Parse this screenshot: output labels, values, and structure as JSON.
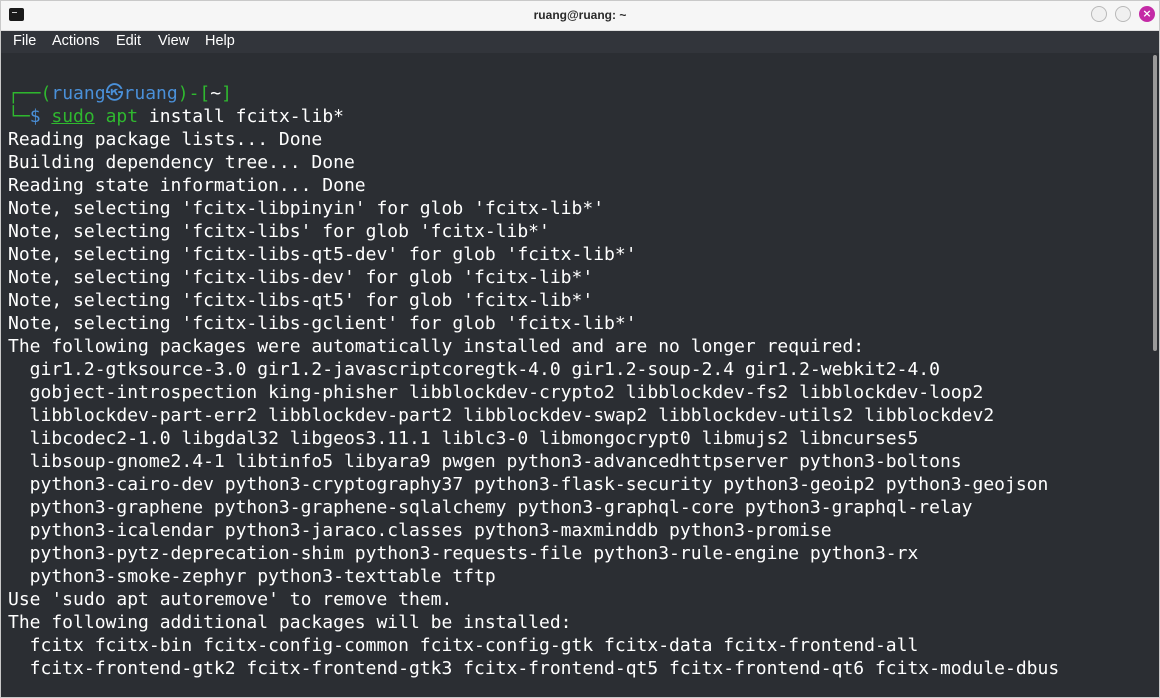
{
  "window": {
    "title": "ruang@ruang: ~",
    "close_glyph": "×"
  },
  "menu": {
    "file": "File",
    "actions": "Actions",
    "edit": "Edit",
    "view": "View",
    "help": "Help"
  },
  "prompt": {
    "corner_top": "┌──",
    "user_open": "(",
    "user": "ruang",
    "at_symbol": "㉿",
    "host": "ruang",
    "close_dir": ")-[",
    "dir": "~",
    "dir_close": "]",
    "corner_bottom": "└─",
    "dollar": "$ ",
    "cmd_sudo": "sudo",
    "cmd_apt": "apt",
    "cmd_rest": " install fcitx-lib*"
  },
  "output": [
    "Reading package lists... Done",
    "Building dependency tree... Done",
    "Reading state information... Done",
    "Note, selecting 'fcitx-libpinyin' for glob 'fcitx-lib*'",
    "Note, selecting 'fcitx-libs' for glob 'fcitx-lib*'",
    "Note, selecting 'fcitx-libs-qt5-dev' for glob 'fcitx-lib*'",
    "Note, selecting 'fcitx-libs-dev' for glob 'fcitx-lib*'",
    "Note, selecting 'fcitx-libs-qt5' for glob 'fcitx-lib*'",
    "Note, selecting 'fcitx-libs-gclient' for glob 'fcitx-lib*'",
    "The following packages were automatically installed and are no longer required:",
    "  gir1.2-gtksource-3.0 gir1.2-javascriptcoregtk-4.0 gir1.2-soup-2.4 gir1.2-webkit2-4.0",
    "  gobject-introspection king-phisher libblockdev-crypto2 libblockdev-fs2 libblockdev-loop2",
    "  libblockdev-part-err2 libblockdev-part2 libblockdev-swap2 libblockdev-utils2 libblockdev2",
    "  libcodec2-1.0 libgdal32 libgeos3.11.1 liblc3-0 libmongocrypt0 libmujs2 libncurses5",
    "  libsoup-gnome2.4-1 libtinfo5 libyara9 pwgen python3-advancedhttpserver python3-boltons",
    "  python3-cairo-dev python3-cryptography37 python3-flask-security python3-geoip2 python3-geojson",
    "  python3-graphene python3-graphene-sqlalchemy python3-graphql-core python3-graphql-relay",
    "  python3-icalendar python3-jaraco.classes python3-maxminddb python3-promise",
    "  python3-pytz-deprecation-shim python3-requests-file python3-rule-engine python3-rx",
    "  python3-smoke-zephyr python3-texttable tftp",
    "Use 'sudo apt autoremove' to remove them.",
    "The following additional packages will be installed:",
    "  fcitx fcitx-bin fcitx-config-common fcitx-config-gtk fcitx-data fcitx-frontend-all",
    "  fcitx-frontend-gtk2 fcitx-frontend-gtk3 fcitx-frontend-qt5 fcitx-frontend-qt6 fcitx-module-dbus"
  ],
  "colors": {
    "terminal_bg": "#2b2e33",
    "prompt_blue": "#4a90d9",
    "prompt_green": "#2fb82f",
    "close_button": "#c42aa6"
  }
}
